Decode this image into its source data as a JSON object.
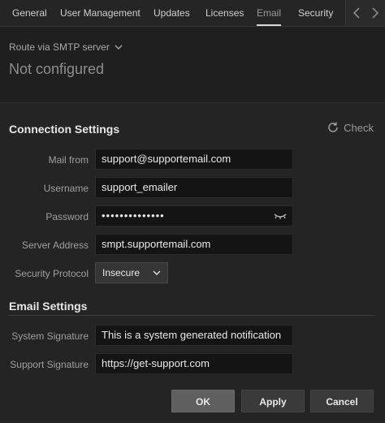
{
  "tabs": [
    {
      "label": "General"
    },
    {
      "label": "User Management"
    },
    {
      "label": "Updates"
    },
    {
      "label": "Licenses"
    },
    {
      "label": "Email"
    },
    {
      "label": "Security"
    }
  ],
  "route": {
    "label": "Route via SMTP server",
    "status": "Not configured"
  },
  "connection": {
    "title": "Connection Settings",
    "check_label": "Check",
    "mail_from": {
      "label": "Mail from",
      "value": "support@supportemail.com"
    },
    "username": {
      "label": "Username",
      "value": "support_emailer"
    },
    "password": {
      "label": "Password",
      "value": "••••••••••••••"
    },
    "server_address": {
      "label": "Server Address",
      "value": "smpt.supportemail.com"
    },
    "security_protocol": {
      "label": "Security Protocol",
      "value": "Insecure"
    }
  },
  "email_settings": {
    "title": "Email Settings",
    "system_signature": {
      "label": "System Signature",
      "value": "This is a system generated notification"
    },
    "support_signature": {
      "label": "Support Signature",
      "value": "https://get-support.com"
    }
  },
  "buttons": {
    "ok": "OK",
    "apply": "Apply",
    "cancel": "Cancel"
  }
}
